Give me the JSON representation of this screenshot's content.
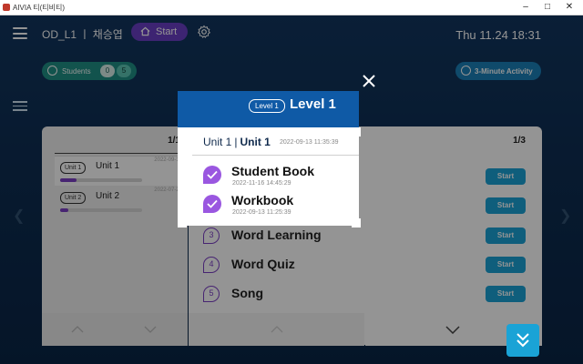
{
  "window": {
    "title": "AIVIA 티(티비티)",
    "minimize": "–",
    "maximize": "□",
    "close": "✕"
  },
  "header": {
    "class_name": "OD_L1 ㅣ 채승엽",
    "start_label": "Start",
    "clock": "Thu 11.24 18:31"
  },
  "students": {
    "label": "Students",
    "count_a": "0",
    "count_b": "5"
  },
  "activity": {
    "label": "3-Minute Activity"
  },
  "left_panel": {
    "pager": "1/1",
    "units": [
      {
        "badge": "Unit 1",
        "name": "Unit 1",
        "date": "2022-09-13",
        "progress": 0.2
      },
      {
        "badge": "Unit 2",
        "name": "Unit 2",
        "date": "2022-07-26",
        "progress": 0.1
      }
    ]
  },
  "right_panel": {
    "pager": "1/3",
    "rows": [
      {
        "num": "3",
        "label": "Word Learning",
        "action": "Start"
      },
      {
        "num": "4",
        "label": "Word Quiz",
        "action": "Start"
      },
      {
        "num": "5",
        "label": "Song",
        "action": "Start"
      }
    ],
    "hidden_actions": [
      "Start",
      "Start"
    ]
  },
  "level": {
    "badge": "Level 1",
    "title": "Level 1"
  },
  "modal": {
    "unit_a": "Unit 1",
    "sep": "|",
    "unit_b": "Unit 1",
    "date": "2022-09-13 11:35:39",
    "books": [
      {
        "label": "Student Book",
        "date": "2022-11-16 14:45:29"
      },
      {
        "label": "Workbook",
        "date": "2022-09-13 11:25:39"
      }
    ]
  },
  "colors": {
    "accent_purple": "#7b3fc4",
    "accent_blue": "#1aa3d6",
    "students_green": "#1f8f86",
    "level_blue": "#0f5aa6"
  }
}
